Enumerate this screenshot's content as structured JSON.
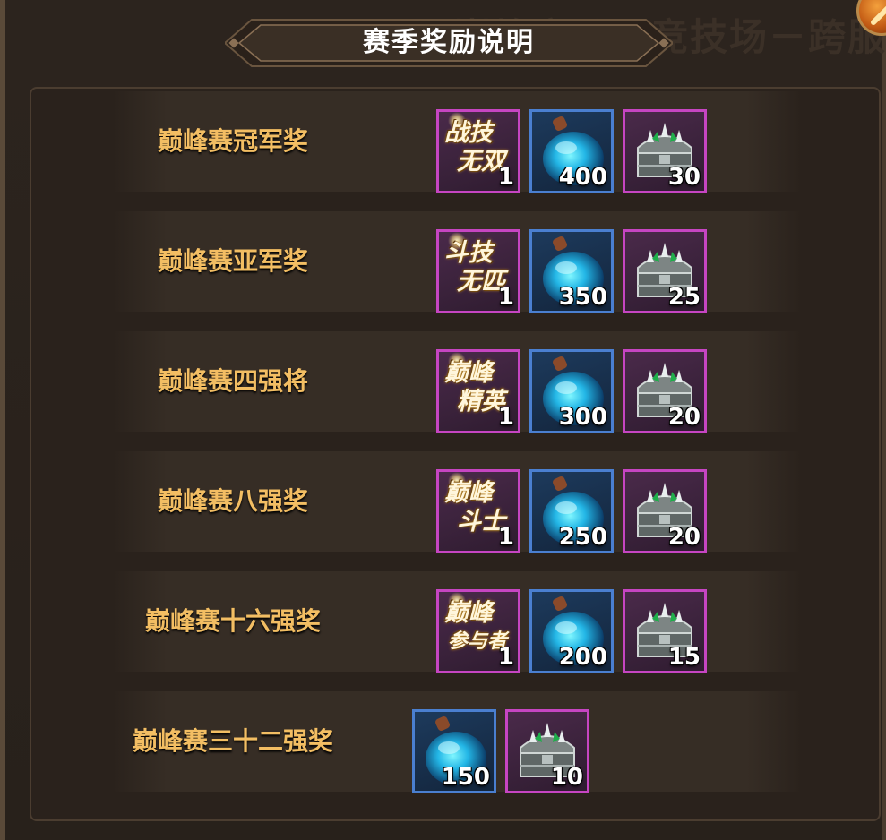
{
  "header": {
    "title": "赛季奖励说明",
    "background_title": "巅峰赛公平竞技场－跨服"
  },
  "colors": {
    "label": "#f3be63",
    "purple_frame": "#c645c2",
    "blue_frame": "#4a7fd0"
  },
  "rewards": [
    {
      "label": "巅峰赛冠军奖",
      "items": [
        {
          "kind": "badge",
          "line1": "战技",
          "line2": "无双",
          "qty": "1",
          "icon": "title-badge-icon"
        },
        {
          "kind": "potion",
          "qty": "400",
          "icon": "blue-potion-icon"
        },
        {
          "kind": "chest",
          "qty": "30",
          "icon": "treasure-chest-icon"
        }
      ]
    },
    {
      "label": "巅峰赛亚军奖",
      "items": [
        {
          "kind": "badge",
          "line1": "斗技",
          "line2": "无匹",
          "qty": "1",
          "icon": "title-badge-icon"
        },
        {
          "kind": "potion",
          "qty": "350",
          "icon": "blue-potion-icon"
        },
        {
          "kind": "chest",
          "qty": "25",
          "icon": "treasure-chest-icon"
        }
      ]
    },
    {
      "label": "巅峰赛四强将",
      "items": [
        {
          "kind": "badge",
          "line1": "巅峰",
          "line2": "精英",
          "qty": "1",
          "icon": "title-badge-icon"
        },
        {
          "kind": "potion",
          "qty": "300",
          "icon": "blue-potion-icon"
        },
        {
          "kind": "chest",
          "qty": "20",
          "icon": "treasure-chest-icon"
        }
      ]
    },
    {
      "label": "巅峰赛八强奖",
      "items": [
        {
          "kind": "badge",
          "line1": "巅峰",
          "line2": "斗士",
          "qty": "1",
          "icon": "title-badge-icon"
        },
        {
          "kind": "potion",
          "qty": "250",
          "icon": "blue-potion-icon"
        },
        {
          "kind": "chest",
          "qty": "20",
          "icon": "treasure-chest-icon"
        }
      ]
    },
    {
      "label": "巅峰赛十六强奖",
      "items": [
        {
          "kind": "badge",
          "line1": "巅峰",
          "line2": "参与者",
          "qty": "1",
          "icon": "title-badge-icon"
        },
        {
          "kind": "potion",
          "qty": "200",
          "icon": "blue-potion-icon"
        },
        {
          "kind": "chest",
          "qty": "15",
          "icon": "treasure-chest-icon"
        }
      ]
    },
    {
      "label": "巅峰赛三十二强奖",
      "items": [
        {
          "kind": "potion",
          "qty": "150",
          "icon": "blue-potion-icon"
        },
        {
          "kind": "chest",
          "qty": "10",
          "icon": "treasure-chest-icon"
        }
      ]
    }
  ]
}
